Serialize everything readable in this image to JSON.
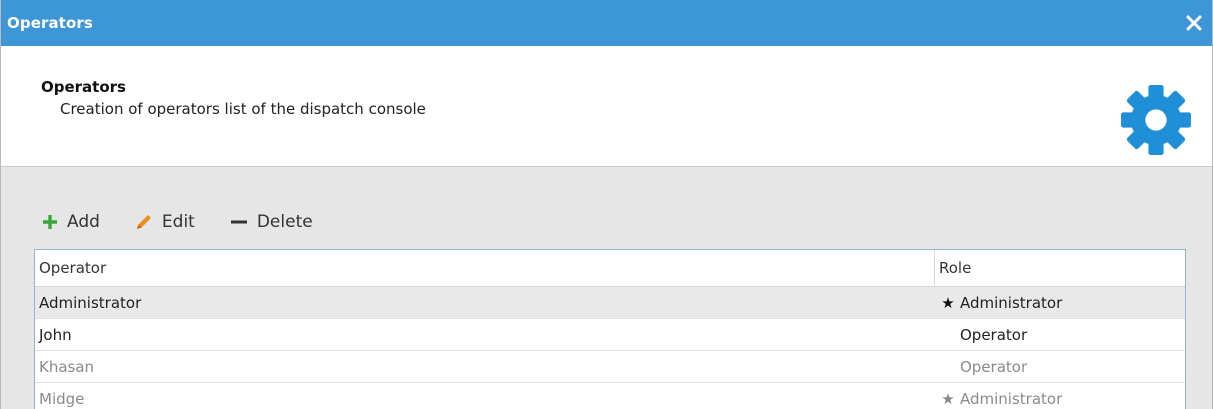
{
  "window": {
    "title": "Operators"
  },
  "header": {
    "title": "Operators",
    "subtitle": "Creation of operators list of the dispatch console",
    "icon": "gear-icon"
  },
  "toolbar": {
    "add_label": "Add",
    "edit_label": "Edit",
    "delete_label": "Delete"
  },
  "table": {
    "columns": [
      "Operator",
      "Role"
    ],
    "rows": [
      {
        "operator": "Administrator",
        "role": "Administrator",
        "role_icon": "star-icon",
        "state": "selected"
      },
      {
        "operator": "John",
        "role": "Operator",
        "role_icon": "",
        "state": "normal"
      },
      {
        "operator": "Khasan",
        "role": "Operator",
        "role_icon": "",
        "state": "disabled"
      },
      {
        "operator": "Midge",
        "role": "Administrator",
        "role_icon": "star-icon",
        "state": "disabled"
      }
    ]
  },
  "colors": {
    "titlebar": "#3d97d6",
    "gear": "#1f8fd8",
    "add": "#3aa63a",
    "edit": "#f08c1a",
    "delete": "#333333"
  }
}
